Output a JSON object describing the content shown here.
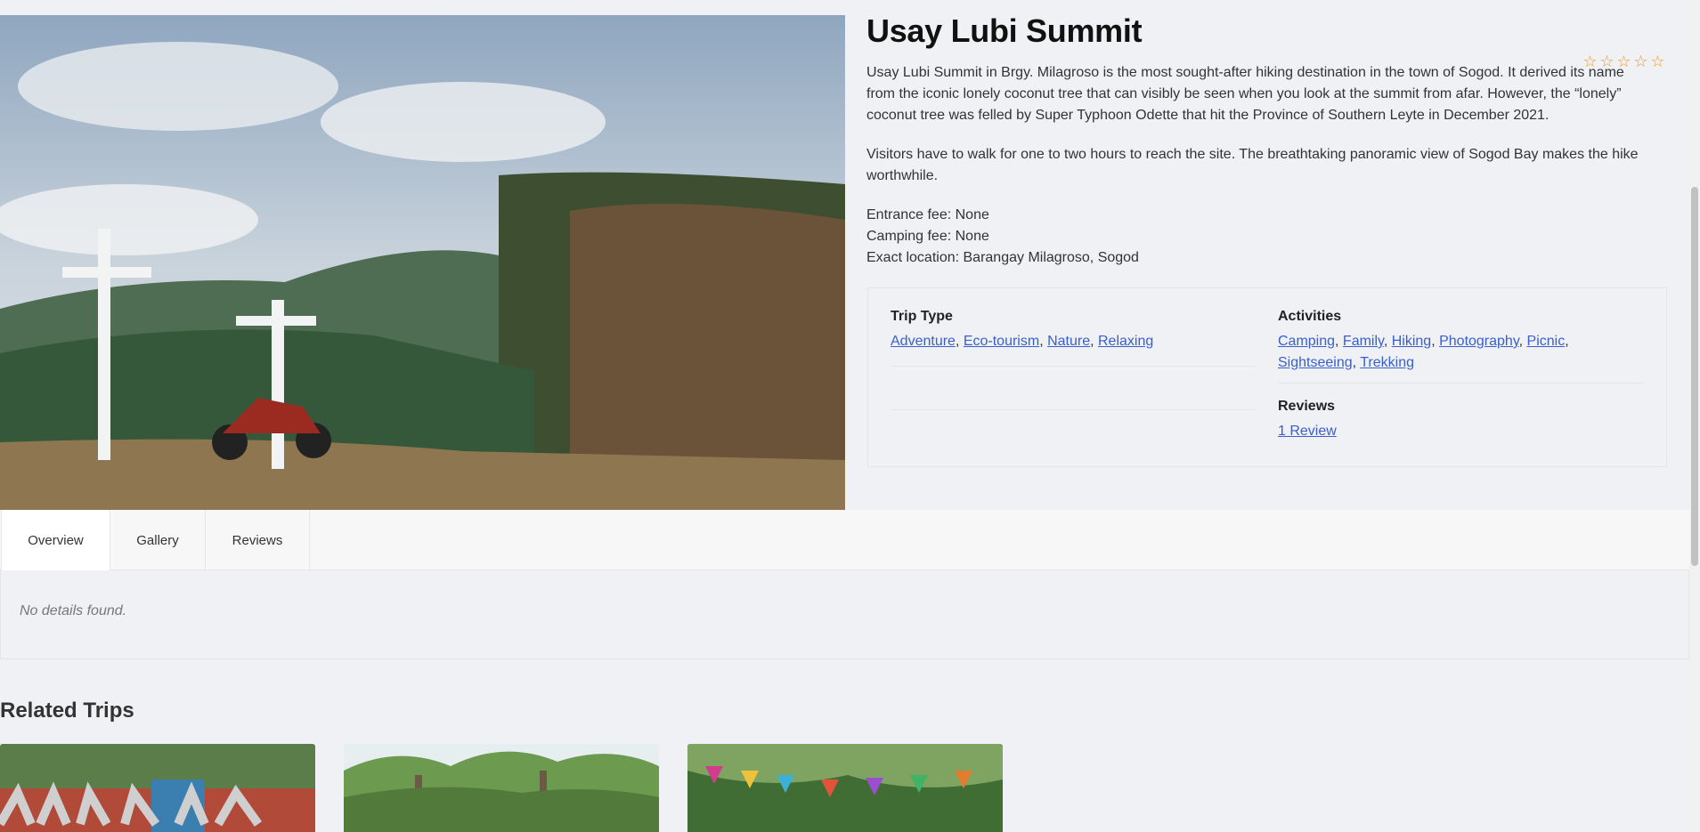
{
  "trip": {
    "title": "Usay Lubi Summit",
    "rating_icon": "star-outline-icon",
    "description": [
      "Usay Lubi Summit in Brgy. Milagroso is the most sought-after hiking destination in the town of Sogod. It derived its name from the iconic lonely coconut tree that can visibly be seen when you look at the summit from afar. However, the “lonely” coconut tree was felled by Super Typhoon Odette that hit the Province of Southern Leyte in December 2021.",
      "Visitors have to walk for one to two hours to reach the site. The breathtaking panoramic view of Sogod Bay makes the hike worthwhile."
    ],
    "fees": {
      "entrance": "Entrance fee: None",
      "camping": "Camping fee: None",
      "location": "Exact location: Barangay Milagroso, Sogod"
    }
  },
  "info": {
    "trip_type_label": "Trip Type",
    "trip_types": [
      "Adventure",
      "Eco-tourism",
      "Nature",
      "Relaxing"
    ],
    "activities_label": "Activities",
    "activities": [
      "Camping",
      "Family",
      "Hiking",
      "Photography",
      "Picnic",
      "Sightseeing",
      "Trekking"
    ],
    "reviews_label": "Reviews",
    "reviews_link": "1 Review"
  },
  "tabs": [
    {
      "label": "Overview",
      "active": true
    },
    {
      "label": "Gallery",
      "active": false
    },
    {
      "label": "Reviews",
      "active": false
    }
  ],
  "panel": {
    "empty_text": "No details found."
  },
  "related": {
    "title": "Related Trips"
  },
  "colors": {
    "link": "#3a5fcd",
    "star": "#e89b34",
    "background": "#eff1f4"
  }
}
